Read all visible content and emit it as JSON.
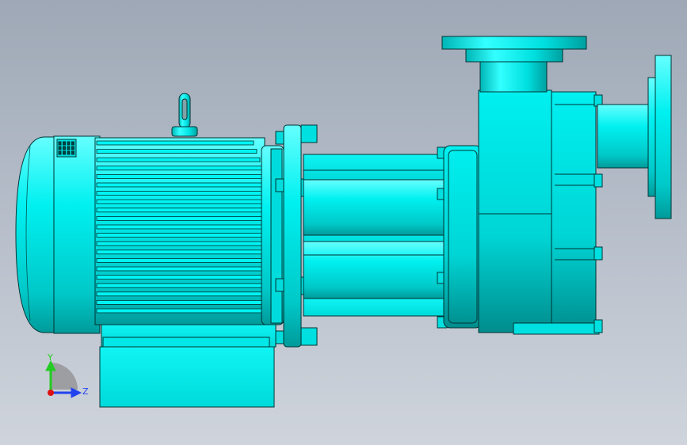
{
  "viewport": {
    "background_top": "#9ea8b6",
    "background_bottom": "#cfd4dc"
  },
  "model": {
    "description_icon": "centrifugal-pump-motor-assembly",
    "body_color": "#00e6e6",
    "edge_color": "#003333",
    "shade_color": "#00aaaa"
  },
  "triad": {
    "y_label": "Y",
    "z_label": "Z",
    "y_color": "#22cc22",
    "z_color": "#2244ee",
    "origin_color": "#dd1111"
  }
}
